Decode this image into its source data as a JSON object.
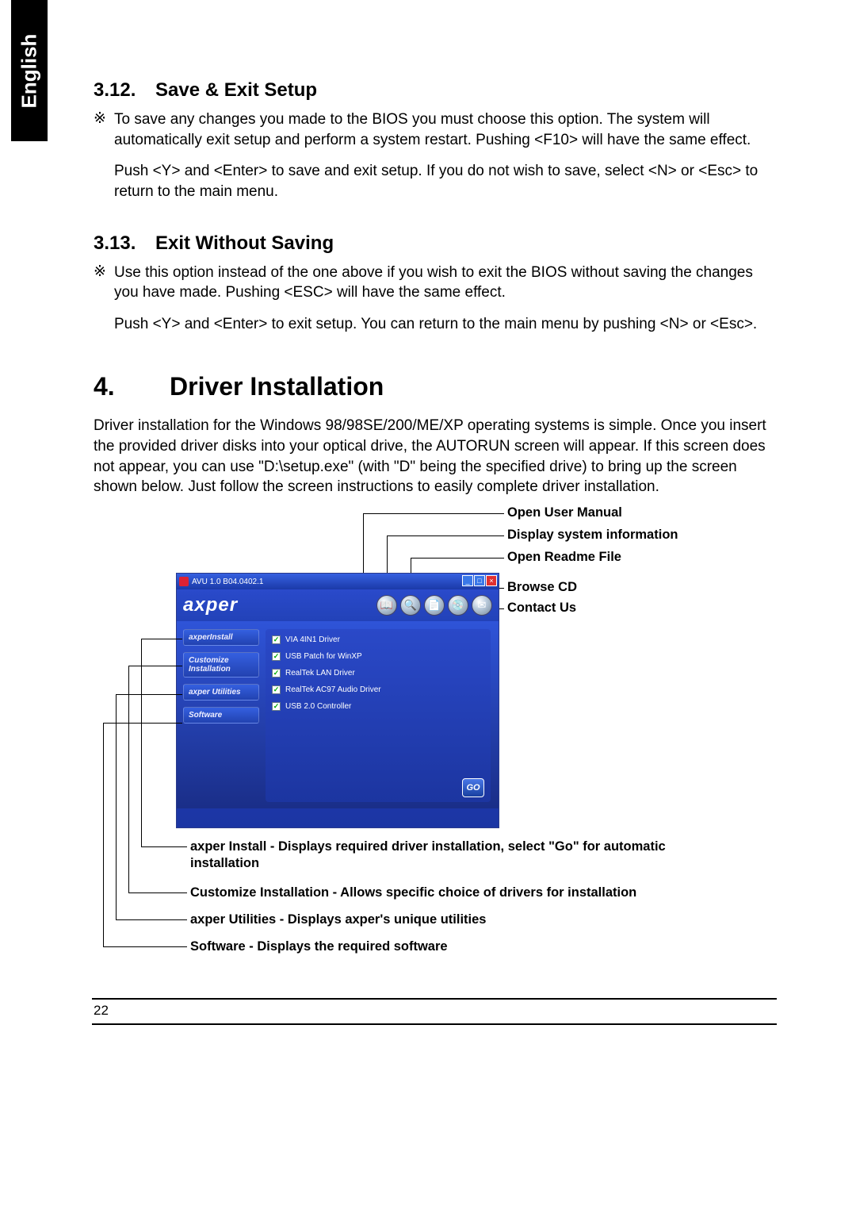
{
  "language_tab": "English",
  "sections": {
    "s312": {
      "num": "3.12.",
      "title": "Save & Exit Setup",
      "bullet": "※",
      "p1": "To save any changes you made to the BIOS you must choose this option.  The system will automatically exit setup and perform a system restart.  Pushing <F10> will have the same effect.",
      "p2": "Push <Y> and <Enter> to save and exit setup.  If you do not wish to save, select  <N> or <Esc> to return to the main menu."
    },
    "s313": {
      "num": "3.13.",
      "title": "Exit Without Saving",
      "bullet": "※",
      "p1": "Use this option instead of the one above if you wish to exit the BIOS without saving the changes you have made.  Pushing <ESC> will have the same effect.",
      "p2": "Push <Y> and <Enter> to exit setup.  You can return to the main menu by pushing <N> or <Esc>."
    }
  },
  "chapter": {
    "num": "4.",
    "title": "Driver Installation",
    "intro": "Driver installation for the Windows 98/98SE/200/ME/XP operating systems is simple.  Once you insert the provided driver disks into your optical drive, the AUTORUN screen will appear.  If this screen does not appear, you can use \"D:\\setup.exe\" (with \"D\" being the specified drive) to bring up the screen shown below. Just follow the screen instructions to easily complete driver installation."
  },
  "callouts_right": [
    "Open User Manual",
    "Display system information",
    "Open Readme File",
    "Browse CD",
    "Contact Us"
  ],
  "installer": {
    "title": "AVU 1.0 B04.0402.1",
    "brand": "axper",
    "sidebar": [
      "axperInstall",
      "Customize Installation",
      "axper Utilities",
      "Software"
    ],
    "drivers": [
      "VIA 4IN1 Driver",
      "USB Patch for WinXP",
      "RealTek LAN Driver",
      "RealTek AC97 Audio Driver",
      "USB 2.0 Controller"
    ],
    "go": "GO",
    "icons": [
      "manual",
      "sysinfo",
      "readme",
      "browse",
      "contact"
    ]
  },
  "callouts_bottom": [
    "axper Install - Displays required driver installation, select \"Go\" for automatic installation",
    "Customize Installation - Allows specific choice of drivers for installation",
    "axper Utilities - Displays axper's unique utilities",
    "Software - Displays the required software"
  ],
  "page_number": "22"
}
